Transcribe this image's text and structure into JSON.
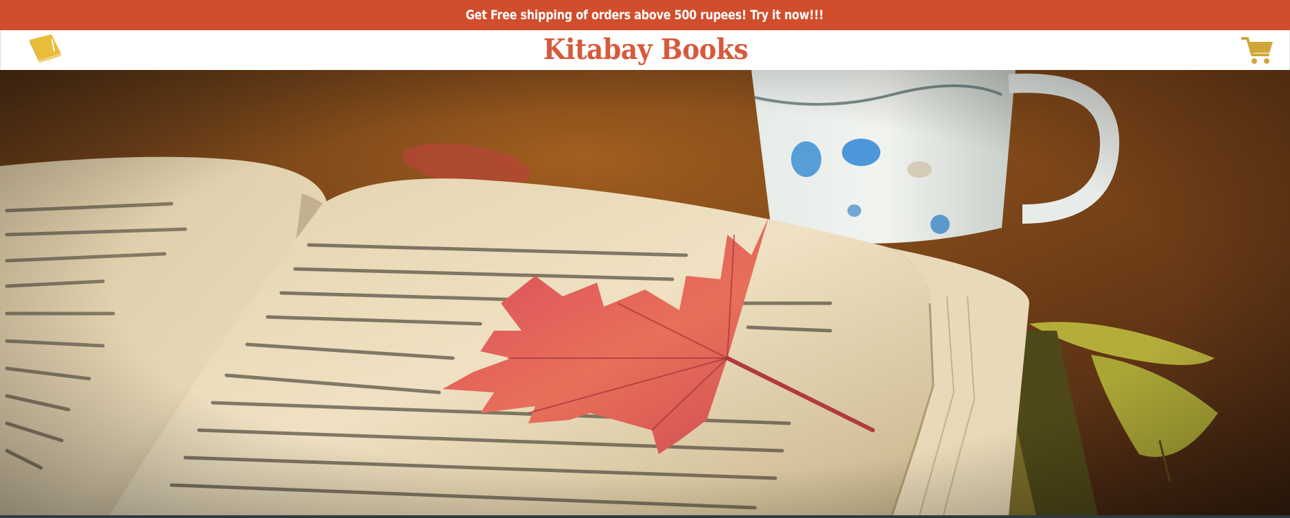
{
  "promo": {
    "text": "Get Free shipping of orders above 500 rupees! Try it now!!!"
  },
  "header": {
    "brand": "Kitabay Books",
    "logo_icon": "book-icon",
    "cart_icon": "shopping-cart-icon"
  },
  "hero": {
    "image": "open-book-with-red-maple-leaf-and-teacup"
  },
  "colors": {
    "promo_bg": "#d14d2c",
    "brand_text": "#d65a3c",
    "icon_yellow": "#e9bc3c",
    "cart_icon": "#cfa63a"
  }
}
